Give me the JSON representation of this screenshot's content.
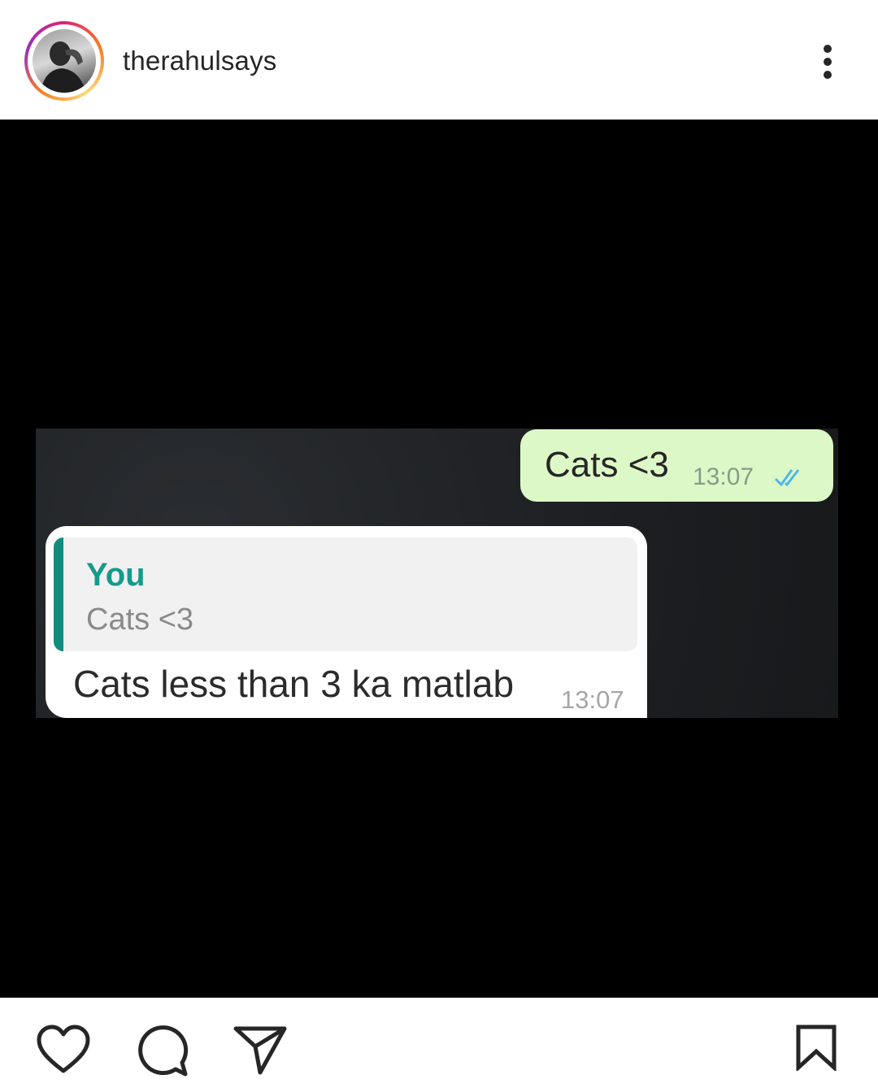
{
  "header": {
    "username": "therahulsays",
    "more_icon": "more-vertical-icon"
  },
  "post": {
    "outgoing": {
      "text": "Cats <3",
      "time": "13:07",
      "status_icon": "double-check-icon"
    },
    "incoming": {
      "quote_author": "You",
      "quote_text": "Cats <3",
      "text": "Cats less than 3 ka matlab",
      "time": "13:07"
    }
  },
  "actions": {
    "like_icon": "heart-icon",
    "comment_icon": "comment-icon",
    "share_icon": "send-icon",
    "save_icon": "bookmark-icon"
  }
}
